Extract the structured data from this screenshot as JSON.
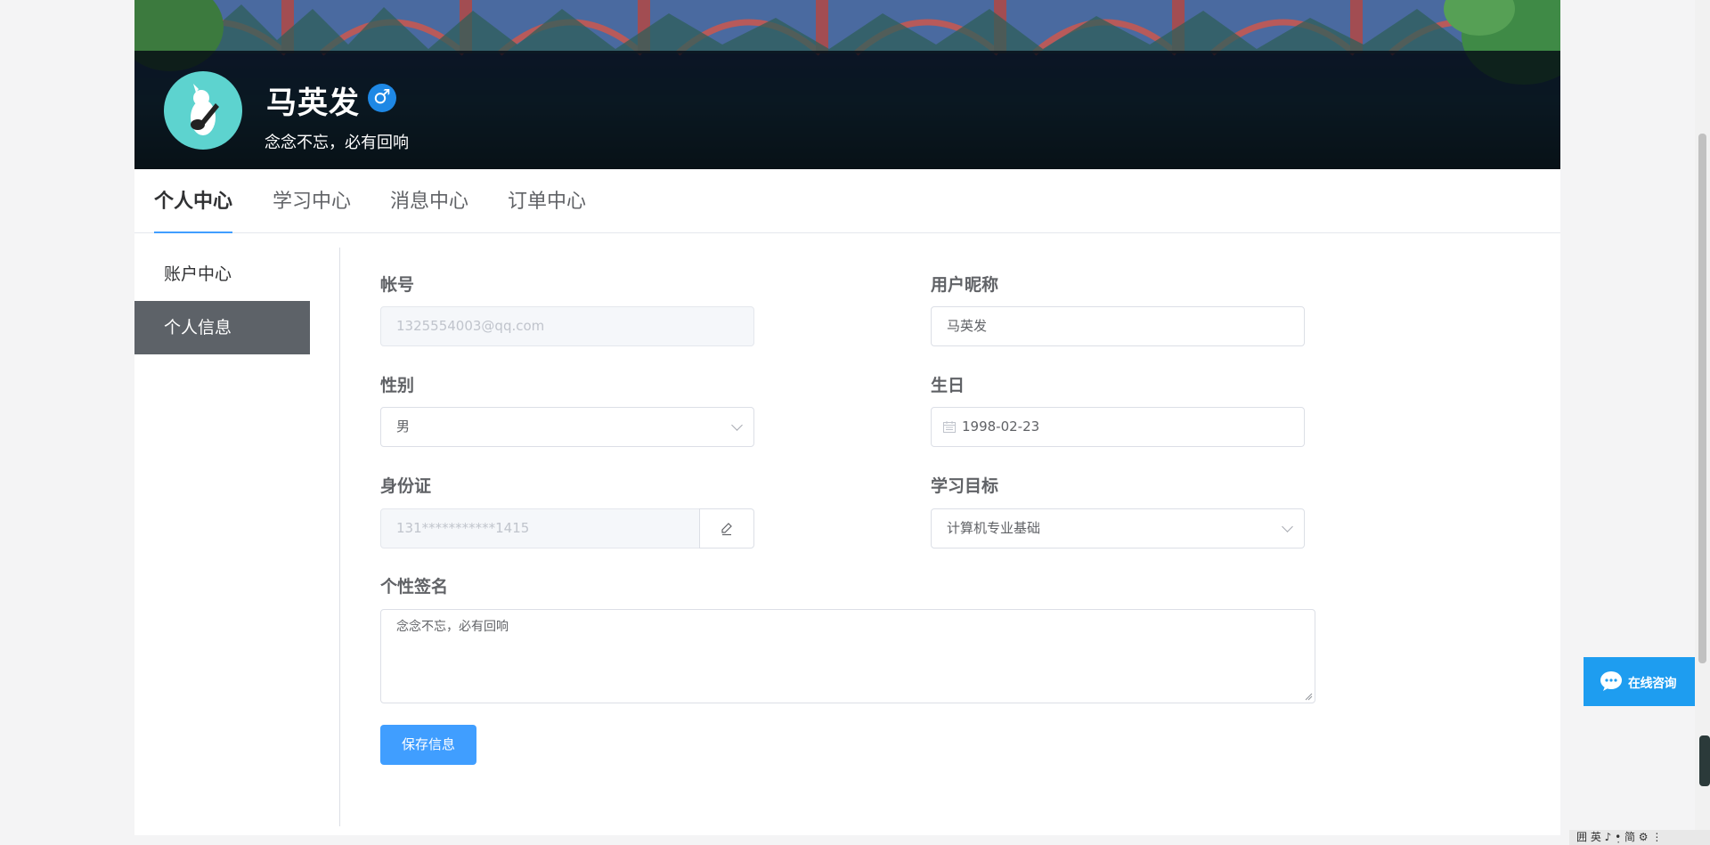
{
  "profile": {
    "name": "马英发",
    "gender_symbol": "♂",
    "motto": "念念不忘，必有回响"
  },
  "tabs": [
    {
      "label": "个人中心",
      "active": true
    },
    {
      "label": "学习中心",
      "active": false
    },
    {
      "label": "消息中心",
      "active": false
    },
    {
      "label": "订单中心",
      "active": false
    }
  ],
  "sidebar": {
    "items": [
      {
        "label": "账户中心",
        "active": false
      },
      {
        "label": "个人信息",
        "active": true
      }
    ]
  },
  "form": {
    "account": {
      "label": "帐号",
      "value": "1325554003@qq.com"
    },
    "nickname": {
      "label": "用户昵称",
      "value": "马英发"
    },
    "gender": {
      "label": "性别",
      "value": "男"
    },
    "birthday": {
      "label": "生日",
      "value": "1998-02-23"
    },
    "id_card": {
      "label": "身份证",
      "value": "131***********1415"
    },
    "goal": {
      "label": "学习目标",
      "value": "计算机专业基础"
    },
    "signature": {
      "label": "个性签名",
      "value": "念念不忘，必有回响"
    },
    "save_label": "保存信息"
  },
  "consult": {
    "label": "在线咨询"
  },
  "ime": {
    "text": "囲 英 ♪ •̣ 简 ⚙ ⋮"
  },
  "colors": {
    "accent": "#409eff",
    "avatar_bg": "#5dd3cf",
    "sidebar_active": "#5d6268",
    "consult_bg": "#1e9df0",
    "gender_badge": "#1e88e5"
  }
}
